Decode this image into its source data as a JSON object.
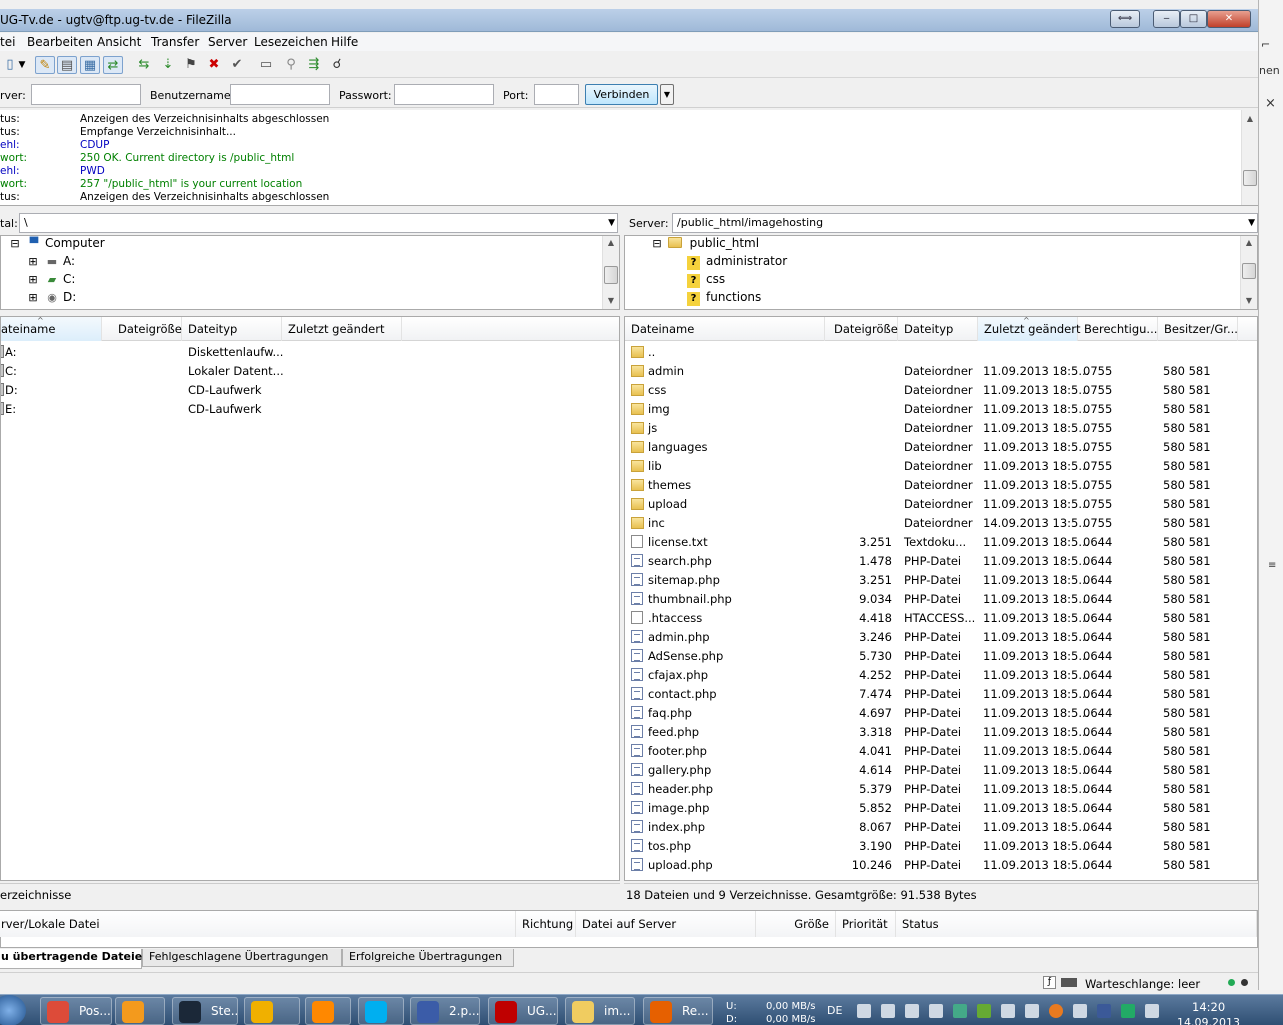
{
  "window": {
    "title": "UG-Tv.de - ugtv@ftp.ug-tv.de - FileZilla",
    "btn_resize": "⟺",
    "btn_min": "‒",
    "btn_max": "□",
    "btn_close": "✕"
  },
  "side": {
    "text_nen": "nen",
    "close": "×"
  },
  "menu": [
    "tei",
    "Bearbeiten",
    "Ansicht",
    "Transfer",
    "Server",
    "Lesezeichen",
    "Hilfe"
  ],
  "quickconnect": {
    "server_label": "rver:",
    "user_label": "Benutzername:",
    "pass_label": "Passwort:",
    "port_label": "Port:",
    "connect_label": "Verbinden",
    "dropdown": "▼"
  },
  "log": [
    {
      "type": "tus:",
      "msg": "Anzeigen des Verzeichnisinhalts abgeschlossen",
      "color": "black"
    },
    {
      "type": "tus:",
      "msg": "Empfange Verzeichnisinhalt...",
      "color": "black"
    },
    {
      "type": "ehl:",
      "msg": "CDUP",
      "color": "blue"
    },
    {
      "type": "wort:",
      "msg": "250 OK. Current directory is /public_html",
      "color": "green"
    },
    {
      "type": "ehl:",
      "msg": "PWD",
      "color": "blue"
    },
    {
      "type": "wort:",
      "msg": "257 \"/public_html\" is your current location",
      "color": "green"
    },
    {
      "type": "tus:",
      "msg": "Anzeigen des Verzeichnisinhalts abgeschlossen",
      "color": "black"
    }
  ],
  "local": {
    "path_label": "tal:",
    "path": "\\",
    "tree": [
      {
        "label": "Computer",
        "icon": "computer-icon"
      },
      {
        "label": "A:",
        "icon": "floppy-icon"
      },
      {
        "label": "C:",
        "icon": "drive-icon"
      },
      {
        "label": "D:",
        "icon": "cd-icon"
      }
    ],
    "columns": [
      "ateiname",
      "Dateigröße",
      "Dateityp",
      "Zuletzt geändert"
    ],
    "files": [
      {
        "name": "A:",
        "type": "Diskettenlaufw..."
      },
      {
        "name": "C:",
        "type": "Lokaler Datent..."
      },
      {
        "name": "D:",
        "type": "CD-Laufwerk"
      },
      {
        "name": "E:",
        "type": "CD-Laufwerk"
      }
    ],
    "status": "erzeichnisse"
  },
  "remote": {
    "path_label": "Server:",
    "path": "/public_html/imagehosting",
    "tree": [
      {
        "label": "public_html",
        "icon": "folder-icon"
      },
      {
        "label": "administrator",
        "icon": "unknown-folder-icon"
      },
      {
        "label": "css",
        "icon": "unknown-folder-icon"
      },
      {
        "label": "functions",
        "icon": "unknown-folder-icon"
      }
    ],
    "columns": [
      "Dateiname",
      "Dateigröße",
      "Dateityp",
      "Zuletzt geändert",
      "Berechtigu...",
      "Besitzer/Gr..."
    ],
    "files": [
      {
        "name": "..",
        "size": "",
        "type": "",
        "date": "",
        "perm": "",
        "owner": "",
        "kind": "folder"
      },
      {
        "name": "admin",
        "size": "",
        "type": "Dateiordner",
        "date": "11.09.2013 18:5...",
        "perm": "0755",
        "owner": "580 581",
        "kind": "folder"
      },
      {
        "name": "css",
        "size": "",
        "type": "Dateiordner",
        "date": "11.09.2013 18:5...",
        "perm": "0755",
        "owner": "580 581",
        "kind": "folder"
      },
      {
        "name": "img",
        "size": "",
        "type": "Dateiordner",
        "date": "11.09.2013 18:5...",
        "perm": "0755",
        "owner": "580 581",
        "kind": "folder"
      },
      {
        "name": "js",
        "size": "",
        "type": "Dateiordner",
        "date": "11.09.2013 18:5...",
        "perm": "0755",
        "owner": "580 581",
        "kind": "folder"
      },
      {
        "name": "languages",
        "size": "",
        "type": "Dateiordner",
        "date": "11.09.2013 18:5...",
        "perm": "0755",
        "owner": "580 581",
        "kind": "folder"
      },
      {
        "name": "lib",
        "size": "",
        "type": "Dateiordner",
        "date": "11.09.2013 18:5...",
        "perm": "0755",
        "owner": "580 581",
        "kind": "folder"
      },
      {
        "name": "themes",
        "size": "",
        "type": "Dateiordner",
        "date": "11.09.2013 18:5...",
        "perm": "0755",
        "owner": "580 581",
        "kind": "folder"
      },
      {
        "name": "upload",
        "size": "",
        "type": "Dateiordner",
        "date": "11.09.2013 18:5...",
        "perm": "0755",
        "owner": "580 581",
        "kind": "folder"
      },
      {
        "name": "inc",
        "size": "",
        "type": "Dateiordner",
        "date": "14.09.2013 13:5...",
        "perm": "0755",
        "owner": "580 581",
        "kind": "folder"
      },
      {
        "name": "license.txt",
        "size": "3.251",
        "type": "Textdoku...",
        "date": "11.09.2013 18:5...",
        "perm": "0644",
        "owner": "580 581",
        "kind": "file"
      },
      {
        "name": "search.php",
        "size": "1.478",
        "type": "PHP-Datei",
        "date": "11.09.2013 18:5...",
        "perm": "0644",
        "owner": "580 581",
        "kind": "php"
      },
      {
        "name": "sitemap.php",
        "size": "3.251",
        "type": "PHP-Datei",
        "date": "11.09.2013 18:5...",
        "perm": "0644",
        "owner": "580 581",
        "kind": "php"
      },
      {
        "name": "thumbnail.php",
        "size": "9.034",
        "type": "PHP-Datei",
        "date": "11.09.2013 18:5...",
        "perm": "0644",
        "owner": "580 581",
        "kind": "php"
      },
      {
        "name": ".htaccess",
        "size": "4.418",
        "type": "HTACCESS...",
        "date": "11.09.2013 18:5...",
        "perm": "0644",
        "owner": "580 581",
        "kind": "file"
      },
      {
        "name": "admin.php",
        "size": "3.246",
        "type": "PHP-Datei",
        "date": "11.09.2013 18:5...",
        "perm": "0644",
        "owner": "580 581",
        "kind": "php"
      },
      {
        "name": "AdSense.php",
        "size": "5.730",
        "type": "PHP-Datei",
        "date": "11.09.2013 18:5...",
        "perm": "0644",
        "owner": "580 581",
        "kind": "php"
      },
      {
        "name": "cfajax.php",
        "size": "4.252",
        "type": "PHP-Datei",
        "date": "11.09.2013 18:5...",
        "perm": "0644",
        "owner": "580 581",
        "kind": "php"
      },
      {
        "name": "contact.php",
        "size": "7.474",
        "type": "PHP-Datei",
        "date": "11.09.2013 18:5...",
        "perm": "0644",
        "owner": "580 581",
        "kind": "php"
      },
      {
        "name": "faq.php",
        "size": "4.697",
        "type": "PHP-Datei",
        "date": "11.09.2013 18:5...",
        "perm": "0644",
        "owner": "580 581",
        "kind": "php"
      },
      {
        "name": "feed.php",
        "size": "3.318",
        "type": "PHP-Datei",
        "date": "11.09.2013 18:5...",
        "perm": "0644",
        "owner": "580 581",
        "kind": "php"
      },
      {
        "name": "footer.php",
        "size": "4.041",
        "type": "PHP-Datei",
        "date": "11.09.2013 18:5...",
        "perm": "0644",
        "owner": "580 581",
        "kind": "php"
      },
      {
        "name": "gallery.php",
        "size": "4.614",
        "type": "PHP-Datei",
        "date": "11.09.2013 18:5...",
        "perm": "0644",
        "owner": "580 581",
        "kind": "php"
      },
      {
        "name": "header.php",
        "size": "5.379",
        "type": "PHP-Datei",
        "date": "11.09.2013 18:5...",
        "perm": "0644",
        "owner": "580 581",
        "kind": "php"
      },
      {
        "name": "image.php",
        "size": "5.852",
        "type": "PHP-Datei",
        "date": "11.09.2013 18:5...",
        "perm": "0644",
        "owner": "580 581",
        "kind": "php"
      },
      {
        "name": "index.php",
        "size": "8.067",
        "type": "PHP-Datei",
        "date": "11.09.2013 18:5...",
        "perm": "0644",
        "owner": "580 581",
        "kind": "php"
      },
      {
        "name": "tos.php",
        "size": "3.190",
        "type": "PHP-Datei",
        "date": "11.09.2013 18:5...",
        "perm": "0644",
        "owner": "580 581",
        "kind": "php"
      },
      {
        "name": "upload.php",
        "size": "10.246",
        "type": "PHP-Datei",
        "date": "11.09.2013 18:5...",
        "perm": "0644",
        "owner": "580 581",
        "kind": "php"
      }
    ],
    "status": "18 Dateien und 9 Verzeichnisse. Gesamtgröße: 91.538 Bytes"
  },
  "queue": {
    "columns": [
      "rver/Lokale Datei",
      "Richtung",
      "Datei auf Server",
      "Größe",
      "Priorität",
      "Status"
    ]
  },
  "tabs": [
    "u übertragende Dateien",
    "Fehlgeschlagene Übertragungen",
    "Erfolgreiche Übertragungen"
  ],
  "bottom": {
    "queue_label": "Warteschlange: leer"
  },
  "taskbar": {
    "tasks": [
      {
        "label": "Pos...",
        "color": "#dd4b39"
      },
      {
        "label": "",
        "color": "#f39a1d"
      },
      {
        "label": "Ste...",
        "color": "#1b2838"
      },
      {
        "label": "",
        "color": "#f0b000"
      },
      {
        "label": "",
        "color": "#ff8800"
      },
      {
        "label": "",
        "color": "#00aff0"
      },
      {
        "label": "2.p...",
        "color": "#3b5ca8"
      },
      {
        "label": "UG...",
        "color": "#bf0000"
      },
      {
        "label": "im...",
        "color": "#f0cc60"
      },
      {
        "label": "Re...",
        "color": "#e66000"
      }
    ],
    "up": "U:",
    "down": "D:",
    "up_rate": "0,00 MB/s",
    "down_rate": "0,00 MB/s",
    "lang": "DE",
    "time": "14:20",
    "date": "14.09.2013"
  }
}
